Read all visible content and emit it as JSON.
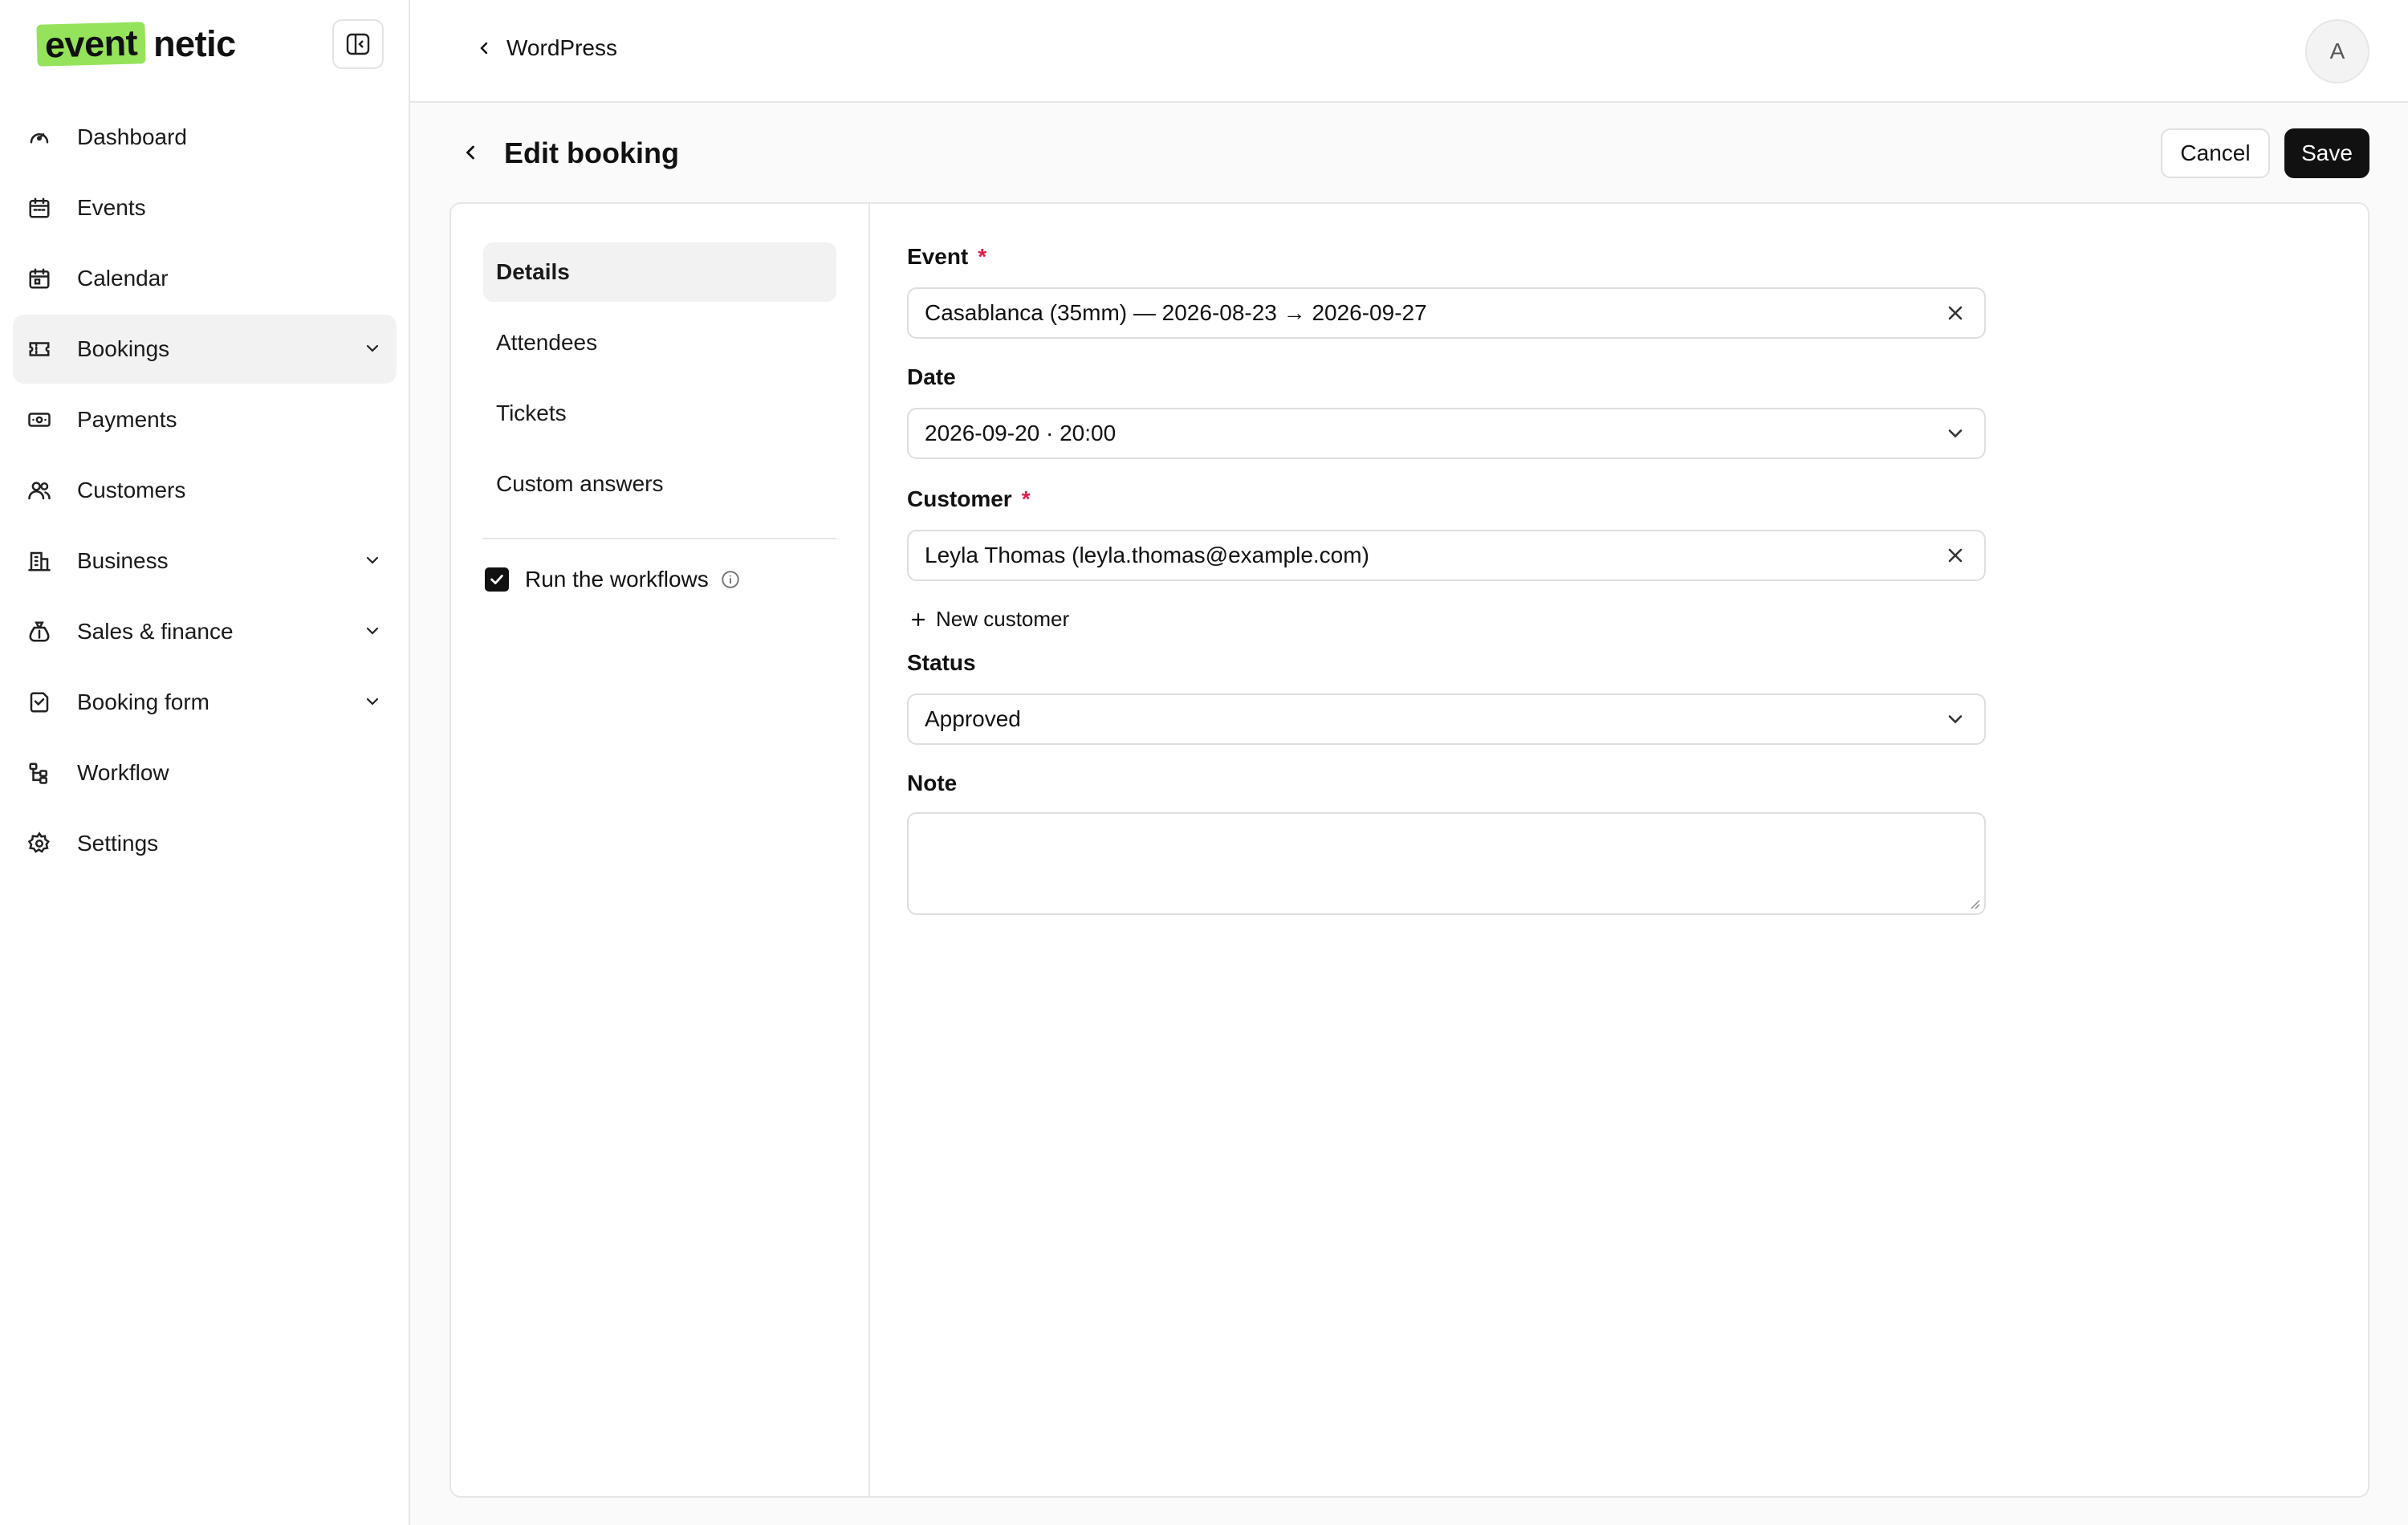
{
  "brand": {
    "logo_highlight": "event",
    "logo_rest": "netic",
    "accent_color": "#95e35a"
  },
  "sidebar": {
    "items": [
      {
        "label": "Dashboard",
        "icon": "gauge-icon"
      },
      {
        "label": "Events",
        "icon": "calendar-icon"
      },
      {
        "label": "Calendar",
        "icon": "calendar-grid-icon"
      },
      {
        "label": "Bookings",
        "icon": "ticket-icon",
        "active": true,
        "expandable": true
      },
      {
        "label": "Payments",
        "icon": "banknote-icon"
      },
      {
        "label": "Customers",
        "icon": "users-icon"
      },
      {
        "label": "Business",
        "icon": "building-icon",
        "expandable": true
      },
      {
        "label": "Sales & finance",
        "icon": "money-bag-icon",
        "expandable": true
      },
      {
        "label": "Booking form",
        "icon": "form-icon",
        "expandable": true
      },
      {
        "label": "Workflow",
        "icon": "workflow-icon"
      },
      {
        "label": "Settings",
        "icon": "gear-icon"
      }
    ]
  },
  "topbar": {
    "back_label": "WordPress",
    "avatar_initial": "A"
  },
  "page": {
    "title": "Edit booking",
    "cancel_label": "Cancel",
    "save_label": "Save"
  },
  "tabs": [
    {
      "label": "Details",
      "active": true
    },
    {
      "label": "Attendees"
    },
    {
      "label": "Tickets"
    },
    {
      "label": "Custom answers"
    }
  ],
  "workflow": {
    "label": "Run the workflows",
    "checked": true
  },
  "form": {
    "event": {
      "label": "Event",
      "required_mark": "*",
      "value": "Casablanca (35mm) — 2026-08-23 → 2026-09-27"
    },
    "date": {
      "label": "Date",
      "value": "2026-09-20 · 20:00"
    },
    "customer": {
      "label": "Customer",
      "required_mark": "*",
      "value": "Leyla Thomas (leyla.thomas@example.com)",
      "new_label": "New customer"
    },
    "status": {
      "label": "Status",
      "value": "Approved"
    },
    "note": {
      "label": "Note",
      "value": ""
    }
  }
}
